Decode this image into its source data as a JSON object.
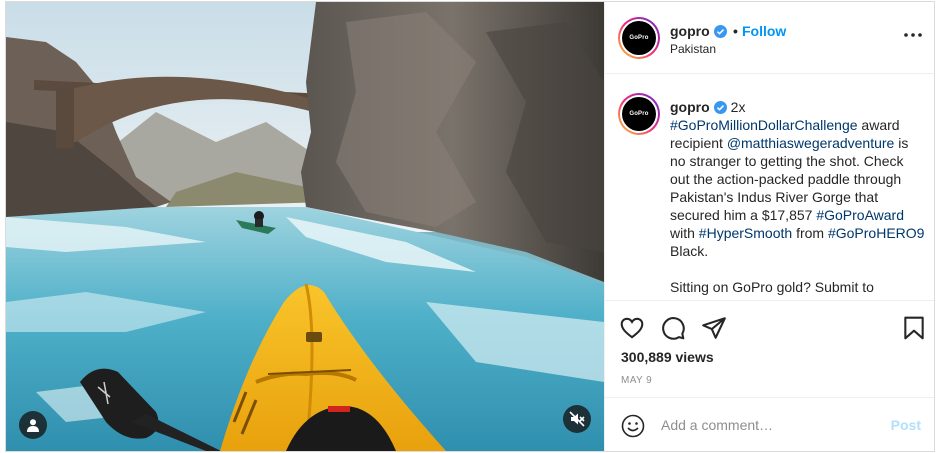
{
  "colors": {
    "accent_link": "#0095f6",
    "hashtag": "#00376b",
    "verified_badge": "#3897f0",
    "muted_text": "#8e8e8e",
    "post_disabled": "#b2dffc",
    "kayak": "#f5b516",
    "water": "#5fb8cf"
  },
  "media": {
    "tag_icon": "user-tag-icon",
    "mute_icon": "volume-off-icon"
  },
  "header": {
    "username": "gopro",
    "verified_icon": "verified-badge-icon",
    "separator": "•",
    "follow_label": "Follow",
    "location": "Pakistan",
    "more_icon": "more-options-icon",
    "avatar_text": "GoPro"
  },
  "caption": {
    "username": "gopro",
    "time_ago": "2x",
    "segments": {
      "tag1": "#GoProMillionDollarChallenge",
      "t1": " award recipient ",
      "mention": "@matthiaswegeradventure",
      "t2": " is no stranger to getting the shot. Check out the action-packed paddle through Pakistan's Indus River Gorge that secured him a $17,857 ",
      "tag2": "#GoProAward",
      "t3": " with ",
      "tag3": "#HyperSmooth",
      "t4": " from ",
      "tag4": "#GoProHERO9",
      "t5": " Black."
    },
    "second_paragraph": "Sitting on GoPro gold? Submit to"
  },
  "actions": {
    "like_icon": "heart-icon",
    "comment_icon": "comment-icon",
    "share_icon": "share-icon",
    "save_icon": "bookmark-icon"
  },
  "stats": {
    "views": "300,889 views",
    "date": "MAY 9"
  },
  "comment": {
    "emoji_icon": "emoji-icon",
    "placeholder": "Add a comment…",
    "post_label": "Post"
  }
}
